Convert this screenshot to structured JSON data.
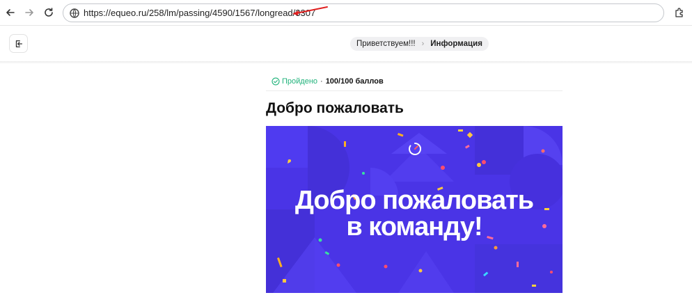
{
  "browser": {
    "url": "https://equeo.ru/258/lm/passing/4590/1567/longread/3307",
    "back_icon": "arrow-left-icon",
    "forward_icon": "arrow-right-icon",
    "reload_icon": "reload-icon",
    "site_info_icon": "site-info-icon",
    "extensions_icon": "puzzle-icon",
    "annotation_color": "#e02020"
  },
  "header": {
    "exit_icon": "exit-icon",
    "breadcrumb": {
      "parent": "Приветствуем!!!",
      "current": "Информация"
    }
  },
  "lesson": {
    "status_label": "Пройдено",
    "status_separator": "·",
    "score": "100/100 баллов",
    "status_color": "#1fb27a",
    "title": "Добро пожаловать",
    "banner": {
      "line1": "Добро пожаловать",
      "line2": "в команду!",
      "background_color": "#4a34e6"
    }
  }
}
